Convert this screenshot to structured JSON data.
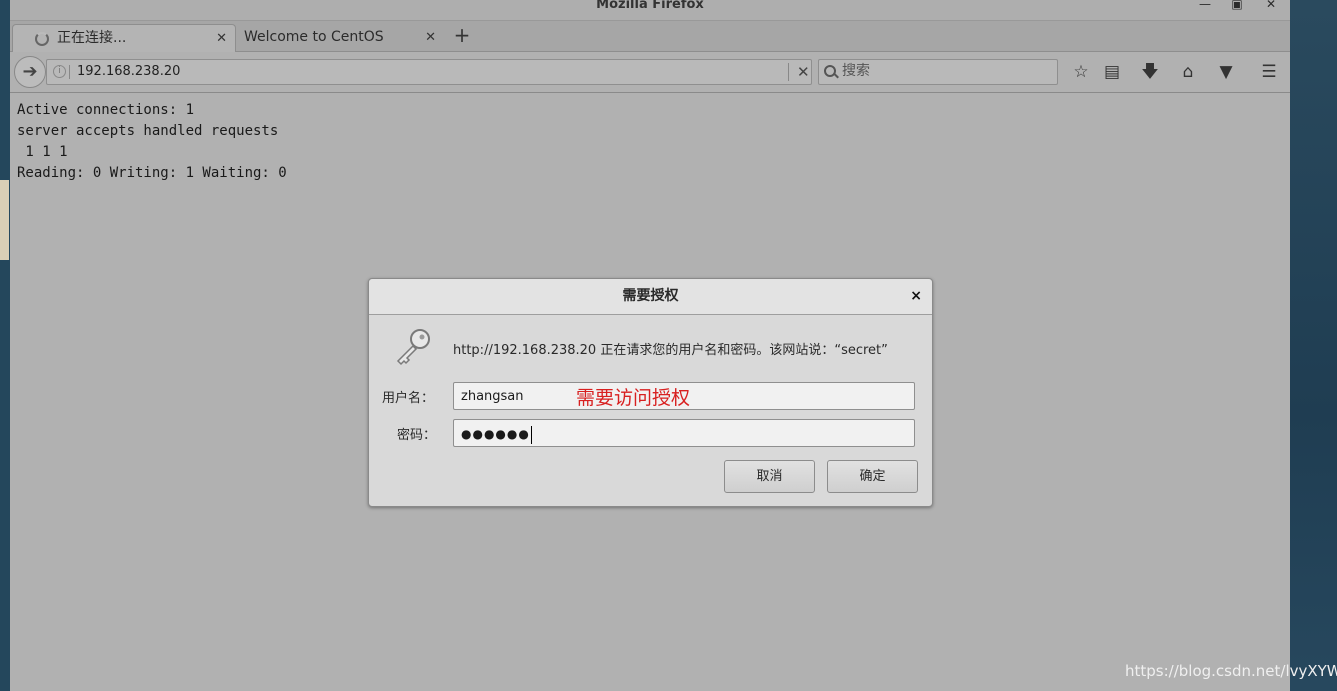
{
  "window": {
    "title": "Mozilla Firefox",
    "controls": [
      "minimize",
      "maximize",
      "close"
    ]
  },
  "tabs": [
    {
      "label": "正在连接...",
      "active": true,
      "loading": true
    },
    {
      "label": "Welcome to CentOS",
      "active": false
    }
  ],
  "navbar": {
    "url": "192.168.238.20",
    "search_placeholder": "搜索",
    "toolbar_icons": [
      "star-icon",
      "reading-list-icon",
      "download-icon",
      "home-icon",
      "pocket-icon",
      "menu-icon"
    ]
  },
  "page": {
    "lines": [
      "Active connections: 1",
      "server accepts handled requests",
      " 1 1 1",
      "Reading: 0 Writing: 1 Waiting: 0"
    ]
  },
  "dialog": {
    "title": "需要授权",
    "close_label": "×",
    "message": "http://192.168.238.20 正在请求您的用户名和密码。该网站说：“secret”",
    "username_label": "用户名：",
    "username_value": "zhangsan",
    "password_label": "密码：",
    "password_value": "●●●●●●",
    "annotation": "需要访问授权",
    "cancel_label": "取消",
    "ok_label": "确定"
  },
  "watermark": "https://blog.csdn.net/lvyXYW",
  "colors": {
    "annotation": "#d82020",
    "background": "#b1b1b1"
  }
}
